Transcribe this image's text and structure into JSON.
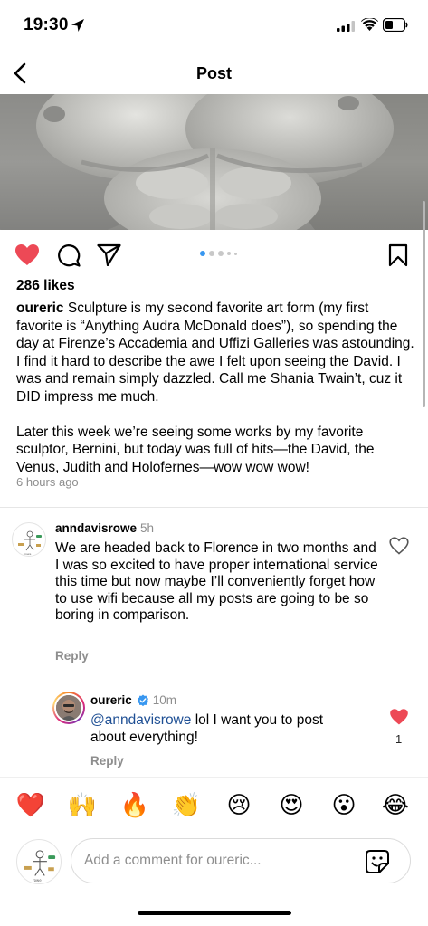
{
  "status_bar": {
    "time": "19:30",
    "icons": [
      "location-arrow-icon",
      "signal-icon",
      "wifi-icon",
      "battery-icon"
    ]
  },
  "nav": {
    "title": "Post",
    "back_icon": "chevron-left-icon"
  },
  "post": {
    "image_description_icon": "sculpture-photo",
    "actions": {
      "icons": [
        "heart-filled-icon",
        "comment-bubble-icon",
        "paper-plane-icon",
        "bookmark-icon"
      ],
      "like_color": "#ed4956",
      "carousel_active_index": 0,
      "carousel_dot_count": 5
    },
    "likes": "286 likes",
    "author": "oureric",
    "caption_first": "Sculpture is my second favorite art form (my first favorite is “Anything Audra McDonald does”), so spending the day at Firenze’s Accademia and Uffizi Galleries was astounding. I find it hard to describe the awe I felt upon seeing the David. I was and remain simply dazzled. Call me Shania Twain’t, cuz it DID impress me much.",
    "caption_second": "Later this week we’re seeing some works by my favorite sculptor, Bernini, but today was full of hits—the David, the Venus, Judith and Holofernes—wow wow wow!",
    "time": "6 hours ago"
  },
  "comments": [
    {
      "username": "anndavisrowe",
      "time": "5h",
      "text": "We are headed back to Florence in two months and I was so excited to have proper international service this time but now maybe I’ll conveniently forget how to use wifi because all my posts are going to be so boring in comparison.",
      "reply_label": "Reply",
      "liked": false
    },
    {
      "username": "oureric",
      "verified": true,
      "time": "10m",
      "mention": "@anndavisrowe",
      "text": " lol I want you to post about everything!",
      "reply_label": "Reply",
      "liked": true,
      "like_count": "1"
    }
  ],
  "emoji_bar": [
    "❤️",
    "🙌",
    "🔥",
    "👏",
    "😢",
    "😍",
    "😮",
    "😂"
  ],
  "comment_input": {
    "placeholder": "Add a comment for oureric...",
    "sticker_icon": "sticker-icon"
  },
  "colors": {
    "like_red": "#ed4956",
    "link_blue": "#1e4f94",
    "verified_blue": "#3897f0",
    "secondary_text": "#8e8e8e"
  }
}
